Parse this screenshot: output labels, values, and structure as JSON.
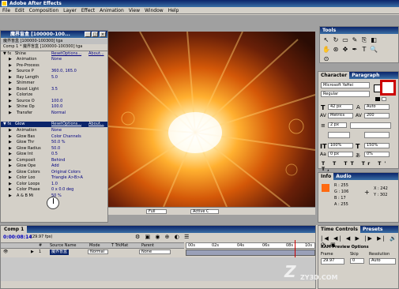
{
  "app": {
    "title": "Adobe After Effects"
  },
  "menu": [
    "File",
    "Edit",
    "Composition",
    "Layer",
    "Effect",
    "Animation",
    "View",
    "Window",
    "Help"
  ],
  "effect_controls": {
    "title": "魔界盲盒 [100000-100...",
    "tab_label": "魔界盲盒 [100000-100300] tga",
    "comp_line": "Comp 1 * 魔界盲盒 [100000-100300] tga",
    "shine": {
      "name": "Shine",
      "reset": "Reset",
      "options": "Options...",
      "about": "About..."
    },
    "shine_rows": [
      {
        "label": "Animation",
        "value": "None"
      },
      {
        "label": "Pre-Process",
        "value": ""
      },
      {
        "label": "Source P",
        "value": "360.0, 165.0"
      },
      {
        "label": "Ray Length",
        "value": "5.0"
      },
      {
        "label": "Shimmer",
        "value": ""
      },
      {
        "label": "Boost Light",
        "value": "3.5"
      },
      {
        "label": "Colorize",
        "value": ""
      },
      {
        "label": "Source O",
        "value": "100.0"
      },
      {
        "label": "Shine Op",
        "value": "100.0"
      },
      {
        "label": "Transfer",
        "value": "Normal"
      }
    ],
    "glow": {
      "name": "Glow",
      "reset": "Reset",
      "options": "Options...",
      "about": "About..."
    },
    "glow_rows": [
      {
        "label": "Animation",
        "value": "None"
      },
      {
        "label": "Glow Bas",
        "value": "Color Channels"
      },
      {
        "label": "Glow Thr",
        "value": "50.0 %"
      },
      {
        "label": "Glow Radius",
        "value": "50.0"
      },
      {
        "label": "Glow Int",
        "value": "0.5"
      },
      {
        "label": "Composit",
        "value": "Behind"
      },
      {
        "label": "Glow Ope",
        "value": "Add"
      },
      {
        "label": "Glow Colors",
        "value": "Original Colors"
      },
      {
        "label": "Color Loo",
        "value": "Triangle A>B>A"
      },
      {
        "label": "Color Loops",
        "value": "1.0"
      },
      {
        "label": "Color Phase",
        "value": "0 x 0.0 deg"
      },
      {
        "label": "A & B Mi",
        "value": "50 %"
      }
    ]
  },
  "viewer": {
    "zoom": "Full",
    "active": "Active C"
  },
  "tools": {
    "title": "Tools"
  },
  "character": {
    "tabs": [
      "Character",
      "Paragraph"
    ],
    "font": "Microsoft YaHei",
    "style": "Regular",
    "size": "42 px",
    "leading": "Auto",
    "kerning": "Metrics",
    "tracking": "200",
    "size2": "2 px",
    "tt1": "100%",
    "tt2": "150%",
    "tt3": "0 px",
    "tt4": "0%"
  },
  "info": {
    "tabs": [
      "Info",
      "Audio"
    ],
    "r": "R : 255",
    "g": "G : 106",
    "b": "B : 17",
    "a": "A : 255",
    "x": "X : 242",
    "y": "Y : 302",
    "swatch": "#ff6a11"
  },
  "time_controls": {
    "tabs": [
      "Time Controls",
      "Presets"
    ],
    "ram_preview": "RAM Preview Options",
    "frame_rate_label": "Frame",
    "skip_label": "Skip",
    "resolution_label": "Resolution",
    "frame_rate": "29.97",
    "skip": "0",
    "resolution": "Auto"
  },
  "timeline": {
    "tab": "Comp 1",
    "timecode": "0:00:08:14",
    "fps": "(29.97 fps)",
    "columns": [
      "#",
      "Source Name",
      "Mode",
      "T TrkMat",
      "Parent"
    ],
    "layer": {
      "num": "1",
      "name": "魔界盲盒",
      "mode": "Normal",
      "parent": "None"
    },
    "ruler": [
      "00s",
      "02s",
      "04s",
      "06s",
      "08s",
      "10s"
    ]
  },
  "watermark": {
    "text": "ZY3D.COM"
  }
}
